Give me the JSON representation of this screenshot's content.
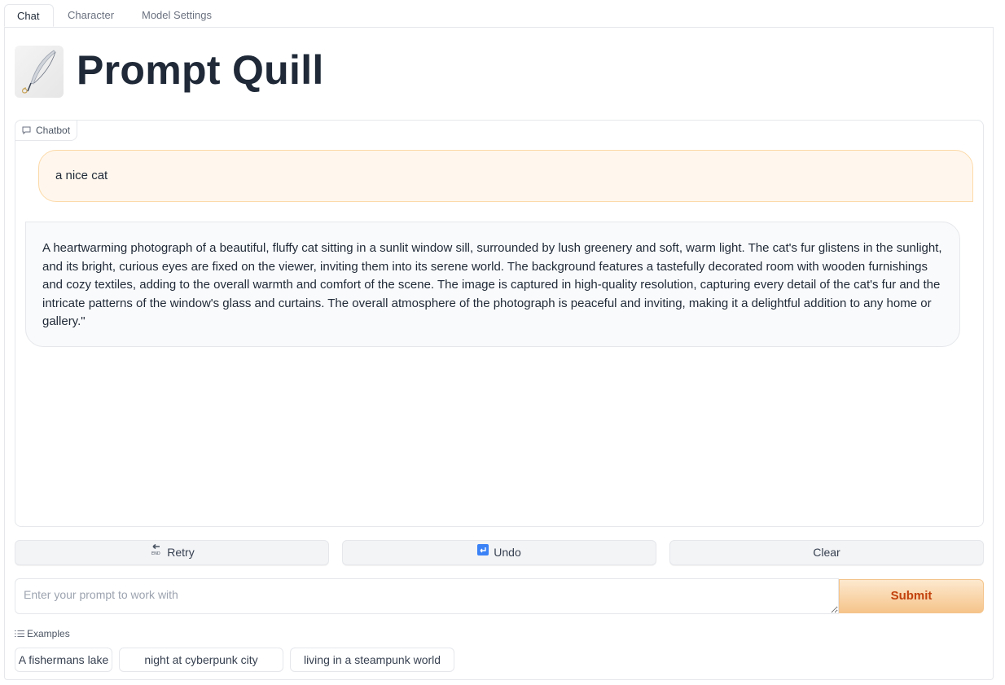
{
  "tabs": [
    {
      "label": "Chat",
      "active": true
    },
    {
      "label": "Character",
      "active": false
    },
    {
      "label": "Model Settings",
      "active": false
    }
  ],
  "app_title": "Prompt Quill",
  "chatbot": {
    "label": "Chatbot",
    "messages": [
      {
        "role": "user",
        "text": "a nice cat"
      },
      {
        "role": "assistant",
        "text": "A heartwarming photograph of a beautiful, fluffy cat sitting in a sunlit window sill, surrounded by lush greenery and soft, warm light. The cat's fur glistens in the sunlight, and its bright, curious eyes are fixed on the viewer, inviting them into its serene world. The background features a tastefully decorated room with wooden furnishings and cozy textiles, adding to the overall warmth and comfort of the scene. The image is captured in high-quality resolution, capturing every detail of the cat's fur and the intricate patterns of the window's glass and curtains. The overall atmosphere of the photograph is peaceful and inviting, making it a delightful addition to any home or gallery.\""
      }
    ]
  },
  "actions": {
    "retry": "Retry",
    "undo": "Undo",
    "clear": "Clear"
  },
  "prompt": {
    "placeholder": "Enter your prompt to work with",
    "value": "",
    "submit_label": "Submit"
  },
  "examples": {
    "label": "Examples",
    "items": [
      "A fishermans lake",
      "night at cyberpunk city",
      "living in a steampunk world"
    ]
  },
  "colors": {
    "accent": "#c2410c",
    "user_bubble": "#fff7ed",
    "submit_gradient_end": "#f5c48a"
  },
  "icons": {
    "logo": "quill-feather-logo",
    "chatbot": "chat-bubble-icon",
    "retry": "retry-end-icon",
    "undo": "undo-icon",
    "examples": "list-icon"
  }
}
